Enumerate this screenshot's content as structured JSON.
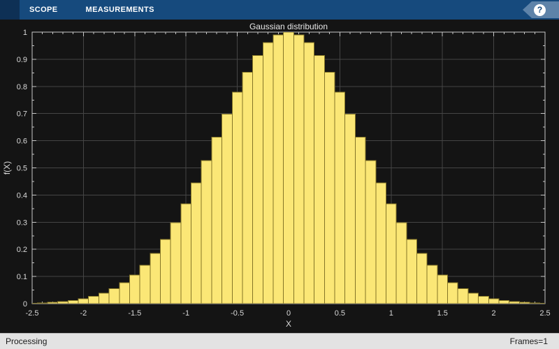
{
  "toolbar": {
    "tabs": [
      {
        "label": "SCOPE"
      },
      {
        "label": "MEASUREMENTS"
      }
    ],
    "help_icon": "?"
  },
  "status_bar": {
    "left": "Processing",
    "right": "Frames=1"
  },
  "colors": {
    "toolbar_bg": "#164a7d",
    "toolbar_corner_bg": "#0e3055",
    "help_flag_bg": "#5e83a9",
    "plot_bg": "#141414",
    "grid": "#454545",
    "axis_box": "#c9c9c9",
    "tick": "#c9c9c9",
    "tick_label": "#d9d9d9",
    "title_text": "#e8e8e8",
    "bar_fill": "#fbe776",
    "bar_edge": "#847527",
    "status_bg": "#e3e3e3",
    "status_text": "#1b1b1b"
  },
  "chart_data": {
    "type": "bar",
    "title": "Gaussian distribution",
    "xlabel": "X",
    "ylabel": "f(X)",
    "xlim": [
      -2.5,
      2.5
    ],
    "ylim": [
      0,
      1
    ],
    "grid": true,
    "legend": "none",
    "bar_width": 0.1,
    "x_ticks": [
      -2.5,
      -2,
      -1.5,
      -1,
      -0.5,
      0,
      0.5,
      1,
      1.5,
      2,
      2.5
    ],
    "x_tick_labels": [
      "-2.5",
      "-2",
      "-1.5",
      "-1",
      "-0.5",
      "0",
      "0.5",
      "1",
      "1.5",
      "2",
      "2.5"
    ],
    "y_ticks": [
      0,
      0.1,
      0.2,
      0.3,
      0.4,
      0.5,
      0.6,
      0.7,
      0.8,
      0.9,
      1
    ],
    "y_tick_labels": [
      "0",
      "0.1",
      "0.2",
      "0.3",
      "0.4",
      "0.5",
      "0.6",
      "0.7",
      "0.8",
      "0.9",
      "1"
    ],
    "x": [
      -2.5,
      -2.4,
      -2.3,
      -2.2,
      -2.1,
      -2.0,
      -1.9,
      -1.8,
      -1.7,
      -1.6,
      -1.5,
      -1.4,
      -1.3,
      -1.2,
      -1.1,
      -1.0,
      -0.9,
      -0.8,
      -0.7,
      -0.6,
      -0.5,
      -0.4,
      -0.3,
      -0.2,
      -0.1,
      0,
      0.1,
      0.2,
      0.3,
      0.4,
      0.5,
      0.6,
      0.7,
      0.8,
      0.9,
      1.0,
      1.1,
      1.2,
      1.3,
      1.4,
      1.5,
      1.6,
      1.7,
      1.8,
      1.9,
      2.0,
      2.1,
      2.2,
      2.3,
      2.4,
      2.5
    ],
    "values": [
      0.0019,
      0.0032,
      0.005,
      0.0079,
      0.0122,
      0.0183,
      0.027,
      0.0392,
      0.0556,
      0.0773,
      0.1054,
      0.1409,
      0.1845,
      0.2369,
      0.2982,
      0.3679,
      0.4449,
      0.5273,
      0.6126,
      0.6977,
      0.7788,
      0.8521,
      0.9139,
      0.9608,
      0.99,
      1.0,
      0.99,
      0.9608,
      0.9139,
      0.8521,
      0.7788,
      0.6977,
      0.6126,
      0.5273,
      0.4449,
      0.3679,
      0.2982,
      0.2369,
      0.1845,
      0.1409,
      0.1054,
      0.0773,
      0.0556,
      0.0392,
      0.027,
      0.0183,
      0.0122,
      0.0079,
      0.005,
      0.0032,
      0.0019
    ]
  }
}
